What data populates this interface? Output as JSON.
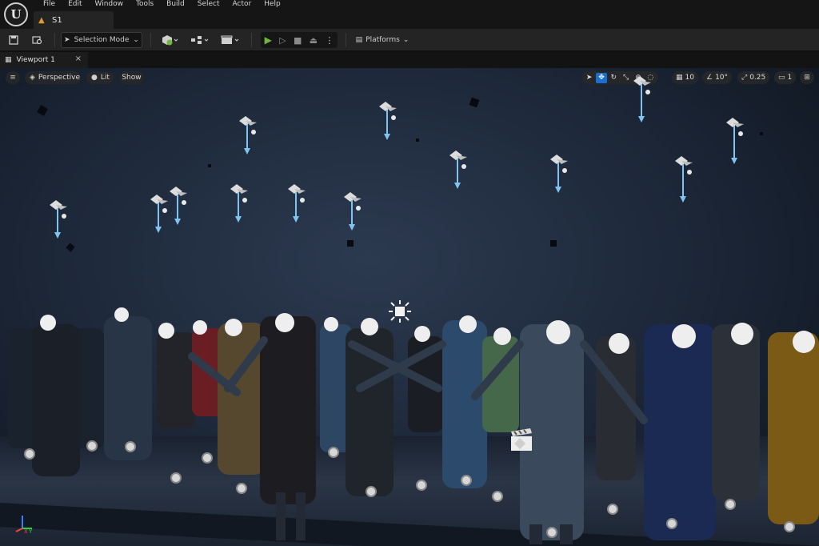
{
  "menu": {
    "logo": "U",
    "items": [
      "File",
      "Edit",
      "Window",
      "Tools",
      "Build",
      "Select",
      "Actor",
      "Help"
    ]
  },
  "level_tab": {
    "name": "S1",
    "icon": "level-icon"
  },
  "toolbar": {
    "mode_label": "Selection Mode",
    "platforms_label": "Platforms",
    "icons": [
      "save-icon",
      "content-browser-icon",
      "add-actor-icon",
      "blueprint-icon",
      "cinematics-icon",
      "play-icon",
      "advance-frame-icon",
      "stop-icon",
      "eject-icon",
      "more-options-icon",
      "platforms-icon"
    ]
  },
  "viewport_tab": {
    "label": "Viewport 1",
    "close": "×"
  },
  "viewport_bar": {
    "perspective_label": "Perspective",
    "lit_label": "Lit",
    "show_label": "Show",
    "grid_snap": "10",
    "rotation_snap": "10°",
    "scale_snap": "0.25",
    "camera_speed": "1"
  },
  "colors": {
    "accent_blue": "#1b6fd1",
    "play_green": "#6fb63b",
    "level_orange": "#e09a2d",
    "light_arrow": "#7fc4f0"
  }
}
